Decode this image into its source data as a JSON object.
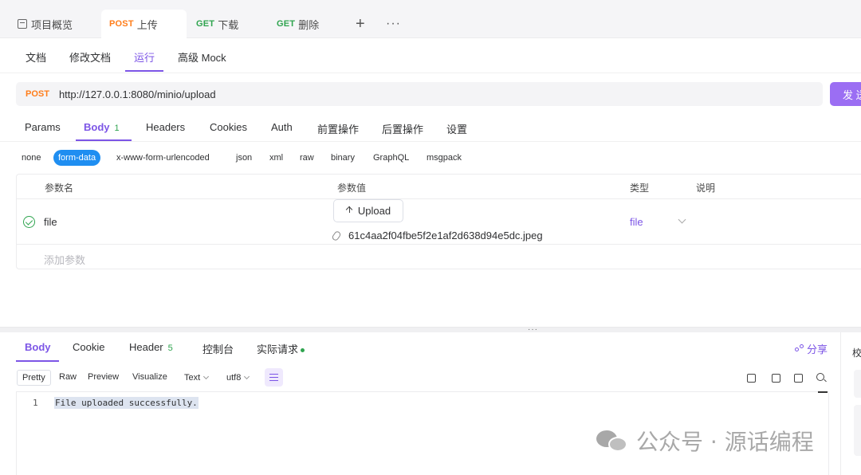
{
  "tabs": {
    "overview": "项目概览",
    "post": {
      "method": "POST",
      "label": "上传"
    },
    "get1": {
      "method": "GET",
      "label": "下载"
    },
    "get2": {
      "method": "GET",
      "label": "删除"
    },
    "plus": "+",
    "more": "···"
  },
  "subtabs": [
    "文档",
    "修改文档",
    "运行",
    "高级 Mock"
  ],
  "request": {
    "method": "POST",
    "url": "http://127.0.0.1:8080/minio/upload",
    "send_label": "发 送"
  },
  "reqtabs": {
    "params": "Params",
    "body": "Body",
    "body_count": "1",
    "headers": "Headers",
    "cookies": "Cookies",
    "auth": "Auth",
    "pre": "前置操作",
    "post": "后置操作",
    "settings": "设置"
  },
  "body_types": [
    "none",
    "form-data",
    "x-www-form-urlencoded",
    "json",
    "xml",
    "raw",
    "binary",
    "GraphQL",
    "msgpack"
  ],
  "params_table": {
    "headers": [
      "参数名",
      "参数值",
      "类型",
      "说明"
    ],
    "row": {
      "name": "file",
      "upload_label": "Upload",
      "file_name": "61c4aa2f04fbe5f2e1af2d638d94e5dc.jpeg",
      "type": "file"
    },
    "add_placeholder": "添加参数"
  },
  "response": {
    "tabs": {
      "body": "Body",
      "cookie": "Cookie",
      "header": "Header",
      "header_count": "5",
      "console": "控制台",
      "actual": "实际请求"
    },
    "share": "分享",
    "view": {
      "pretty": "Pretty",
      "raw": "Raw",
      "preview": "Preview",
      "visualize": "Visualize",
      "format": "Text",
      "encoding": "utf8"
    },
    "line_number": "1",
    "content": "File uploaded successfully."
  },
  "right_panel_label": "校",
  "watermark": "公众号 · 源话编程",
  "colors": {
    "accent": "#7c55e6",
    "post": "#ff7d1a",
    "get": "#2fa44f",
    "chip": "#1f8ef1"
  }
}
